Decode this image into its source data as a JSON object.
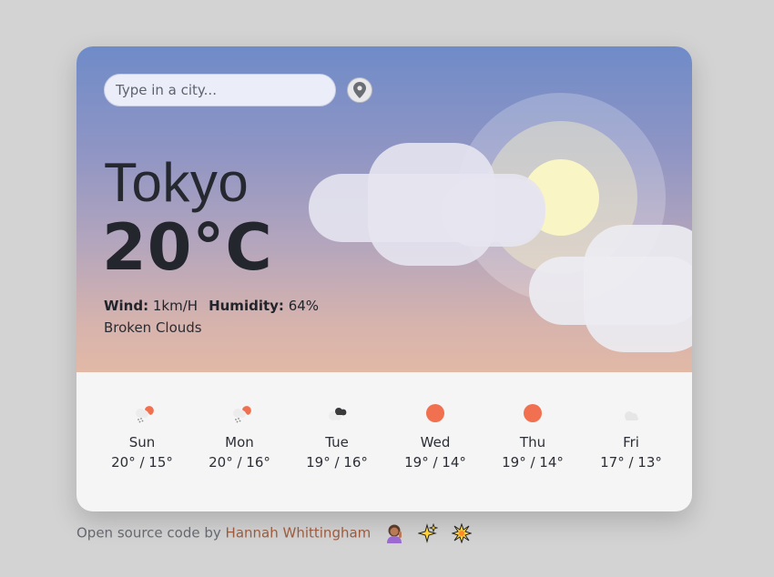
{
  "search": {
    "placeholder": "Type in a city..."
  },
  "current": {
    "city": "Tokyo",
    "temperature": "20°C",
    "wind_label": "Wind:",
    "wind_value": "1km/H",
    "humidity_label": "Humidity:",
    "humidity_value": "64%",
    "description": "Broken Clouds"
  },
  "forecast": [
    {
      "day": "Sun",
      "range": "20° / 15°",
      "icon": "light-rain-icon"
    },
    {
      "day": "Mon",
      "range": "20° / 16°",
      "icon": "light-rain-icon"
    },
    {
      "day": "Tue",
      "range": "19° / 16°",
      "icon": "dark-clouds-icon"
    },
    {
      "day": "Wed",
      "range": "19° / 14°",
      "icon": "sun-icon"
    },
    {
      "day": "Thu",
      "range": "19° / 14°",
      "icon": "sun-icon"
    },
    {
      "day": "Fri",
      "range": "17° / 13°",
      "icon": "cloud-icon"
    }
  ],
  "footer": {
    "prefix": "Open source code by",
    "author": "Hannah Whittingham",
    "emojis": [
      "woman-tipping-hand-emoji",
      "sparkles-emoji",
      "collision-emoji"
    ]
  },
  "colors": {
    "sky_top": "#6f8bc8",
    "sky_bottom": "#e2b9a6",
    "sun_core": "#f8f3c4",
    "sun_orange": "#f07050",
    "author_link": "#9c5b3e"
  }
}
